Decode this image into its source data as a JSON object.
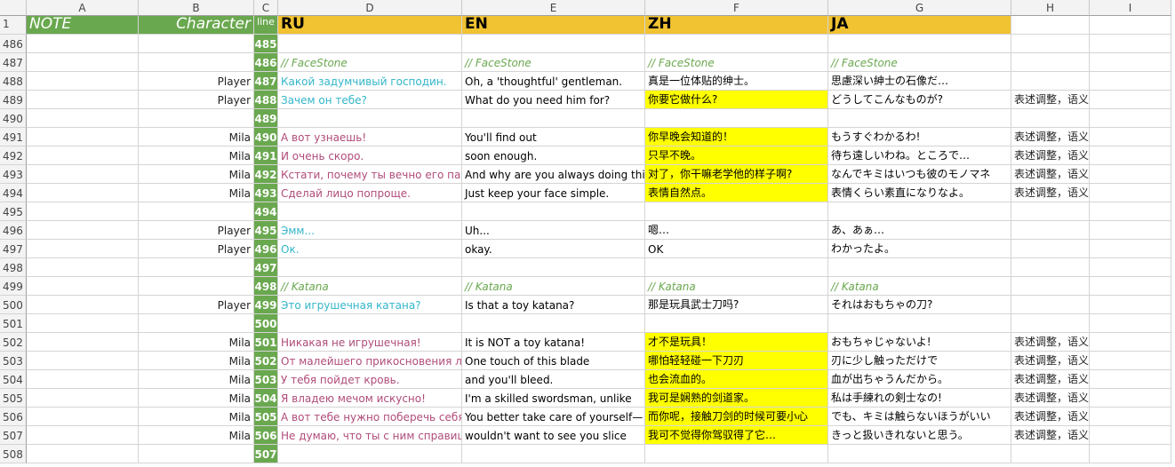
{
  "column_letters": [
    "A",
    "B",
    "C",
    "D",
    "E",
    "F",
    "G",
    "H",
    "I"
  ],
  "header": {
    "row_number": "1",
    "note": "NOTE",
    "character": "Character",
    "line": "line",
    "ru": "RU",
    "en": "EN",
    "zh": "ZH",
    "ja": "JA"
  },
  "rows": [
    {
      "rn": "486",
      "char": "",
      "line": "485",
      "ru": "",
      "en": "",
      "zh": "",
      "ja": "",
      "note": "",
      "type": "blank",
      "zh_yellow": false
    },
    {
      "rn": "487",
      "char": "",
      "line": "486",
      "ru": "// FaceStone",
      "en": "// FaceStone",
      "zh": "// FaceStone",
      "ja": "// FaceStone",
      "note": "",
      "type": "comment",
      "zh_yellow": false
    },
    {
      "rn": "488",
      "char": "Player",
      "line": "487",
      "ru": "Какой задумчивый господин.",
      "en": "Oh, a 'thoughtful' gentleman.",
      "zh": "真是一位体贴的绅士。",
      "ja": "思慮深い紳士の石像だ…",
      "note": "",
      "type": "player",
      "zh_yellow": false
    },
    {
      "rn": "489",
      "char": "Player",
      "line": "488",
      "ru": "Зачем он тебе?",
      "en": "What do you need him for?",
      "zh": "你要它做什么?",
      "ja": "どうしてこんなものが?",
      "note": "表述调整，语义不变",
      "type": "player",
      "zh_yellow": true
    },
    {
      "rn": "490",
      "char": "",
      "line": "489",
      "ru": "",
      "en": "",
      "zh": "",
      "ja": "",
      "note": "",
      "type": "blank",
      "zh_yellow": false
    },
    {
      "rn": "491",
      "char": "Mila",
      "line": "490",
      "ru": "А вот узнаешь!",
      "en": "You'll find out",
      "zh": "你早晚会知道的！",
      "ja": "もうすぐわかるわ!",
      "note": "表述调整，语义不变",
      "type": "mila",
      "zh_yellow": true
    },
    {
      "rn": "492",
      "char": "Mila",
      "line": "491",
      "ru": "И очень скоро.",
      "en": "soon enough.",
      "zh": "只早不晚。",
      "ja": "待ち遠しいわね。ところで…",
      "note": "表述调整，语义不变",
      "type": "mila",
      "zh_yellow": true
    },
    {
      "rn": "493",
      "char": "Mila",
      "line": "492",
      "ru": "Кстати, почему ты вечно его пар",
      "en": "And why are you always doing this",
      "zh": "对了，你干嘛老学他的样子啊?",
      "ja": "なんでキミはいつも彼のモノマネ",
      "note": "表述调整，语义不变",
      "type": "mila",
      "zh_yellow": true
    },
    {
      "rn": "494",
      "char": "Mila",
      "line": "493",
      "ru": "Сделай лицо попроще.",
      "en": "Just keep your face simple.",
      "zh": "表情自然点。",
      "ja": "表情くらい素直になりなよ。",
      "note": "表述调整，语义不变",
      "type": "mila",
      "zh_yellow": true
    },
    {
      "rn": "495",
      "char": "",
      "line": "494",
      "ru": "",
      "en": "",
      "zh": "",
      "ja": "",
      "note": "",
      "type": "blank",
      "zh_yellow": false
    },
    {
      "rn": "496",
      "char": "Player",
      "line": "495",
      "ru": "Эмм...",
      "en": "Uh...",
      "zh": "嗯…",
      "ja": "あ、あぁ…",
      "note": "",
      "type": "player",
      "zh_yellow": false
    },
    {
      "rn": "497",
      "char": "Player",
      "line": "496",
      "ru": "Ок.",
      "en": "okay.",
      "zh": "OK",
      "ja": "わかったよ。",
      "note": "",
      "type": "player",
      "zh_yellow": false
    },
    {
      "rn": "498",
      "char": "",
      "line": "497",
      "ru": "",
      "en": "",
      "zh": "",
      "ja": "",
      "note": "",
      "type": "blank",
      "zh_yellow": false
    },
    {
      "rn": "499",
      "char": "",
      "line": "498",
      "ru": "// Katana",
      "en": "// Katana",
      "zh": "// Katana",
      "ja": "// Katana",
      "note": "",
      "type": "comment",
      "zh_yellow": false
    },
    {
      "rn": "500",
      "char": "Player",
      "line": "499",
      "ru": "Это игрушечная катана?",
      "en": "Is that a toy katana?",
      "zh": "那是玩具武士刀吗?",
      "ja": "それはおもちゃの刀?",
      "note": "",
      "type": "player",
      "zh_yellow": false
    },
    {
      "rn": "501",
      "char": "",
      "line": "500",
      "ru": "",
      "en": "",
      "zh": "",
      "ja": "",
      "note": "",
      "type": "blank",
      "zh_yellow": false
    },
    {
      "rn": "502",
      "char": "Mila",
      "line": "501",
      "ru": "Никакая не игрушечная!",
      "en": "It is NOT a toy katana!",
      "zh": "才不是玩具！",
      "ja": "おもちゃじゃないよ!",
      "note": "表述调整，语义不变",
      "type": "mila",
      "zh_yellow": true
    },
    {
      "rn": "503",
      "char": "Mila",
      "line": "502",
      "ru": "От малейшего прикосновения ле",
      "en": "One touch of this blade",
      "zh": "哪怕轻轻碰一下刀刃",
      "ja": "刃に少し触っただけで",
      "note": "表述调整，语义不变",
      "type": "mila",
      "zh_yellow": true
    },
    {
      "rn": "504",
      "char": "Mila",
      "line": "503",
      "ru": "У тебя пойдет кровь.",
      "en": "and you'll bleed.",
      "zh": "也会流血的。",
      "ja": "血が出ちゃうんだから。",
      "note": "表述调整，语义不变",
      "type": "mila",
      "zh_yellow": true
    },
    {
      "rn": "505",
      "char": "Mila",
      "line": "504",
      "ru": "Я владею мечом искусно!",
      "en": "I'm a skilled swordsman, unlike",
      "zh": "我可是娴熟的剑道家。",
      "ja": "私は手練れの剣士なの!",
      "note": "表述调整，语义不变",
      "type": "mila",
      "zh_yellow": true
    },
    {
      "rn": "506",
      "char": "Mila",
      "line": "505",
      "ru": "А вот тебе нужно поберечь себя.",
      "en": "You better take care of yourself—",
      "zh": "而你呢，接触刀剑的时候可要小心",
      "ja": "でも、キミは触らないほうがいい",
      "note": "表述调整，语义不变",
      "type": "mila",
      "zh_yellow": true
    },
    {
      "rn": "507",
      "char": "Mila",
      "line": "506",
      "ru": "Не думаю, что ты с ним справиш",
      "en": "wouldn't want to see you slice",
      "zh": "我可不觉得你驾驭得了它…",
      "ja": "きっと扱いきれないと思う。",
      "note": "表述调整，语义不变",
      "type": "mila",
      "zh_yellow": true
    },
    {
      "rn": "508",
      "char": "",
      "line": "507",
      "ru": "",
      "en": "",
      "zh": "",
      "ja": "",
      "note": "",
      "type": "blank",
      "zh_yellow": false
    }
  ],
  "colors": {
    "green": "#6aa84f",
    "gold": "#f1c232",
    "yellow": "#ffff00",
    "ru_player": "#33b6c9",
    "ru_mila": "#b04c7a"
  }
}
